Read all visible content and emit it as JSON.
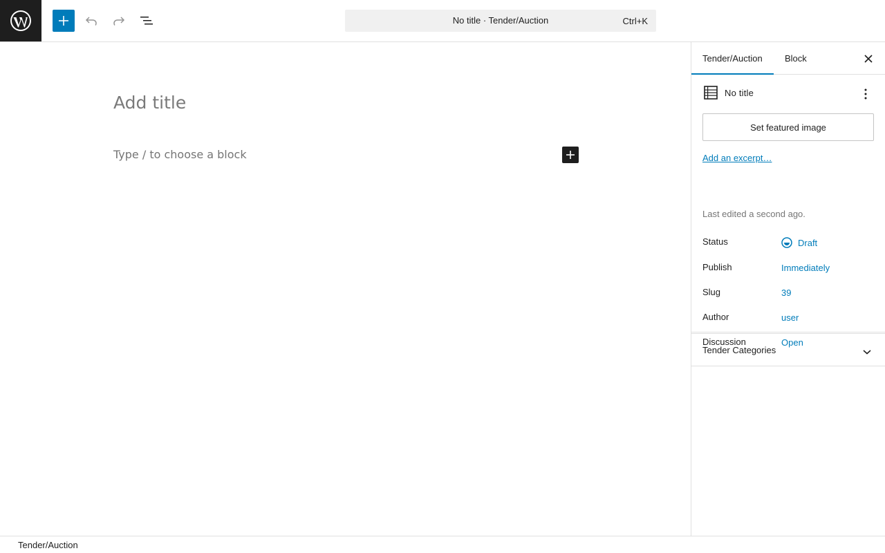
{
  "header": {
    "command_title": "No title · Tender/Auction",
    "command_shortcut": "Ctrl+K"
  },
  "canvas": {
    "title_placeholder": "Add title",
    "block_placeholder": "Type / to choose a block"
  },
  "sidebar": {
    "tabs": [
      {
        "label": "Tender/Auction"
      },
      {
        "label": "Block"
      }
    ],
    "post_title": "No title",
    "featured_image_label": "Set featured image",
    "excerpt_link": "Add an excerpt…",
    "last_edited": "Last edited a second ago.",
    "rows": [
      {
        "label": "Status",
        "value": "Draft"
      },
      {
        "label": "Publish",
        "value": "Immediately"
      },
      {
        "label": "Slug",
        "value": "39"
      },
      {
        "label": "Author",
        "value": "user"
      },
      {
        "label": "Discussion",
        "value": "Open"
      }
    ],
    "taxonomy_panel": "Tender Categories"
  },
  "footer": {
    "breadcrumb": "Tender/Auction"
  },
  "colors": {
    "accent": "#007cba",
    "dark": "#1e1e1e",
    "border": "#e0e0e0"
  }
}
